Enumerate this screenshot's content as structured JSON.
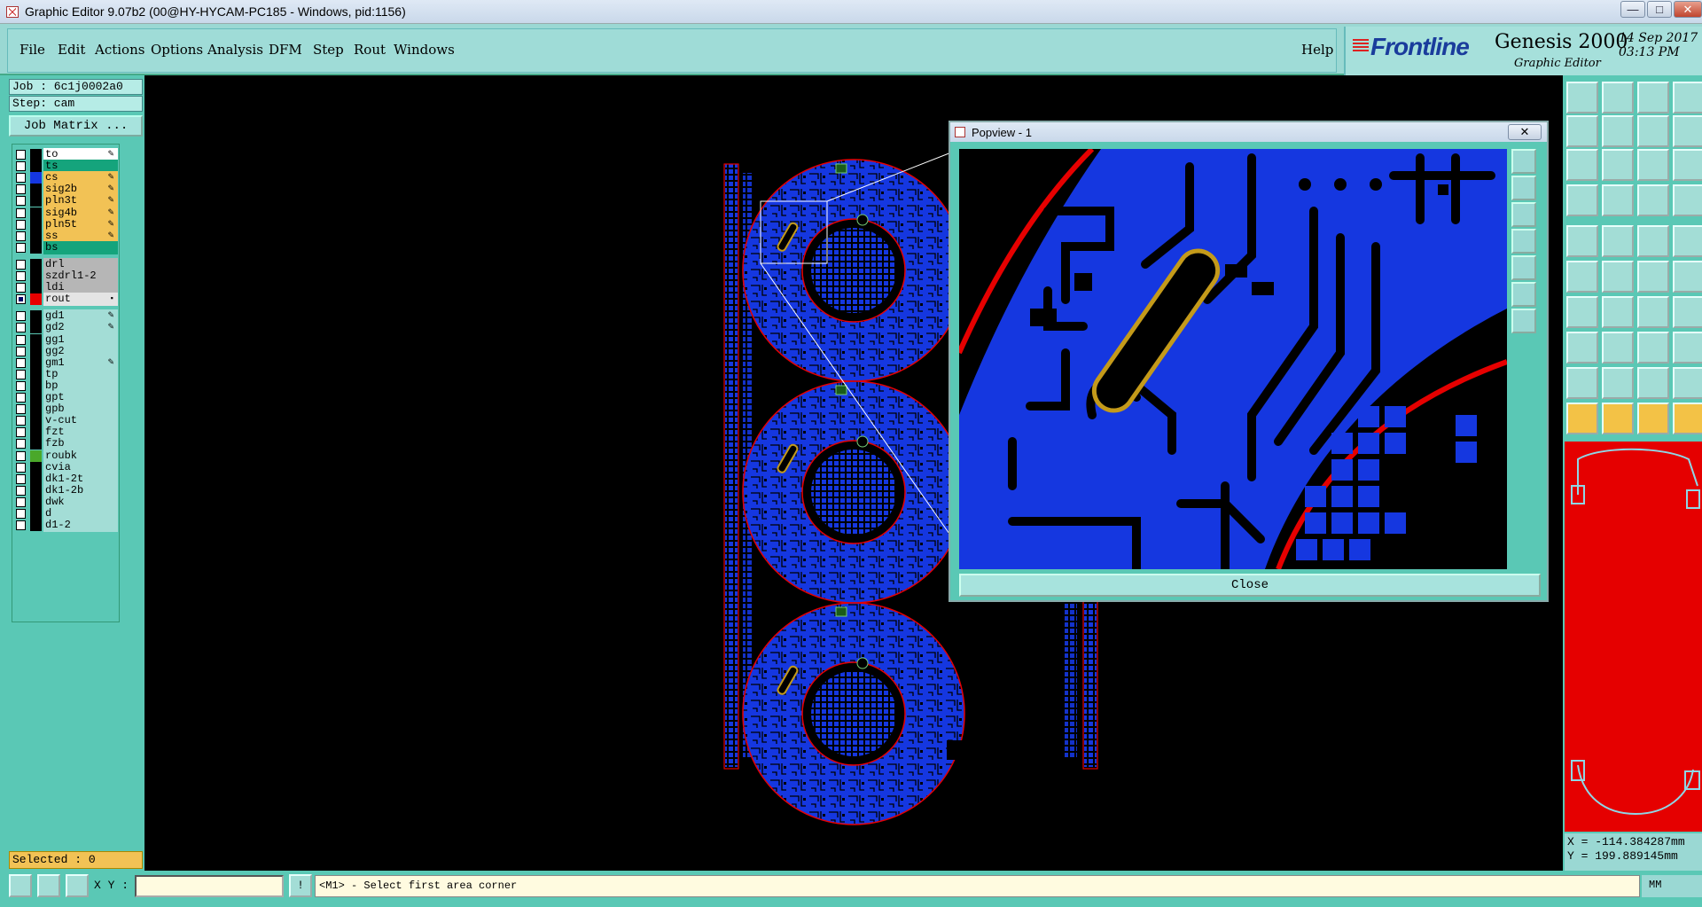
{
  "window": {
    "title": "Graphic Editor 9.07b2 (00@HY-HYCAM-PC185 - Windows, pid:1156)",
    "controls": {
      "minimize": "—",
      "maximize": "□",
      "close": "✕"
    }
  },
  "menu": {
    "items": [
      "File",
      "Edit",
      "Actions",
      "Options",
      "Analysis",
      "DFM",
      "Step",
      "Rout",
      "Windows"
    ],
    "help": "Help"
  },
  "brand": {
    "logo": "Frontline",
    "product": "Genesis 2000",
    "subtitle": "Graphic Editor",
    "date": "14 Sep 2017",
    "time": "03:13 PM"
  },
  "job": {
    "job_label": "Job : 6c1j0002a0",
    "step_label": "Step: cam",
    "matrix_button": "Job Matrix ..."
  },
  "layers": [
    {
      "name": "to",
      "bg": "#ffffff",
      "swatch": "#000000",
      "mark": "✎"
    },
    {
      "name": "ts",
      "bg": "#15a47c",
      "swatch": "#000000",
      "mark": ""
    },
    {
      "name": "cs",
      "bg": "#f2c255",
      "swatch": "#1537e0",
      "mark": "✎"
    },
    {
      "name": "sig2b",
      "bg": "#f2c255",
      "swatch": "#000000",
      "mark": "✎"
    },
    {
      "name": "pln3t",
      "bg": "#f2c255",
      "swatch": "#000000",
      "mark": "✎"
    },
    {
      "name": "sig4b",
      "bg": "#f2c255",
      "swatch": "#000000",
      "mark": "✎"
    },
    {
      "name": "pln5t",
      "bg": "#f2c255",
      "swatch": "#000000",
      "mark": "✎"
    },
    {
      "name": "ss",
      "bg": "#f2c255",
      "swatch": "#000000",
      "mark": "✎"
    },
    {
      "name": "bs",
      "bg": "#15a47c",
      "swatch": "#000000",
      "mark": ""
    },
    {
      "name": "drl",
      "bg": "#b6b6b6",
      "swatch": "#000000",
      "mark": ""
    },
    {
      "name": "szdrl1-2",
      "bg": "#b6b6b6",
      "swatch": "#000000",
      "mark": ""
    },
    {
      "name": "ldi",
      "bg": "#b6b6b6",
      "swatch": "#000000",
      "mark": ""
    },
    {
      "name": "rout",
      "bg": "#e4e4e4",
      "swatch": "#e60000",
      "mark": "▪",
      "on": true
    },
    {
      "name": "gd1",
      "bg": "#a3ddd6",
      "swatch": "#000000",
      "mark": "✎"
    },
    {
      "name": "gd2",
      "bg": "#a3ddd6",
      "swatch": "#000000",
      "mark": "✎"
    },
    {
      "name": "gg1",
      "bg": "#a3ddd6",
      "swatch": "#000000",
      "mark": ""
    },
    {
      "name": "gg2",
      "bg": "#a3ddd6",
      "swatch": "#000000",
      "mark": ""
    },
    {
      "name": "gm1",
      "bg": "#a3ddd6",
      "swatch": "#000000",
      "mark": "✎"
    },
    {
      "name": "tp",
      "bg": "#a3ddd6",
      "swatch": "#000000",
      "mark": ""
    },
    {
      "name": "bp",
      "bg": "#a3ddd6",
      "swatch": "#000000",
      "mark": ""
    },
    {
      "name": "gpt",
      "bg": "#a3ddd6",
      "swatch": "#000000",
      "mark": ""
    },
    {
      "name": "gpb",
      "bg": "#a3ddd6",
      "swatch": "#000000",
      "mark": ""
    },
    {
      "name": "v-cut",
      "bg": "#a3ddd6",
      "swatch": "#000000",
      "mark": ""
    },
    {
      "name": "fzt",
      "bg": "#a3ddd6",
      "swatch": "#000000",
      "mark": ""
    },
    {
      "name": "fzb",
      "bg": "#a3ddd6",
      "swatch": "#000000",
      "mark": ""
    },
    {
      "name": "roubk",
      "bg": "#a3ddd6",
      "swatch": "#4aa82a",
      "mark": ""
    },
    {
      "name": "cvia",
      "bg": "#a3ddd6",
      "swatch": "#000000",
      "mark": ""
    },
    {
      "name": "dk1-2t",
      "bg": "#a3ddd6",
      "swatch": "#000000",
      "mark": ""
    },
    {
      "name": "dk1-2b",
      "bg": "#a3ddd6",
      "swatch": "#000000",
      "mark": ""
    },
    {
      "name": "dwk",
      "bg": "#a3ddd6",
      "swatch": "#000000",
      "mark": ""
    },
    {
      "name": "d",
      "bg": "#a3ddd6",
      "swatch": "#000000",
      "mark": ""
    },
    {
      "name": "d1-2",
      "bg": "#a3ddd6",
      "swatch": "#000000",
      "mark": ""
    }
  ],
  "selected": "Selected : 0",
  "popview": {
    "title": "Popview - 1",
    "close_x": "✕",
    "close_button": "Close"
  },
  "coords": {
    "x": "X = -114.384287mm",
    "y": "Y = 199.889145mm"
  },
  "status": {
    "xy_label": "X Y :",
    "xy_value": "",
    "message": "<M1> - Select first area corner",
    "units": "MM",
    "bang": "!"
  },
  "colors": {
    "accent": "#5ac8b5",
    "copper": "#1537e0",
    "rout": "#e60000",
    "slot": "#c49a1a"
  }
}
